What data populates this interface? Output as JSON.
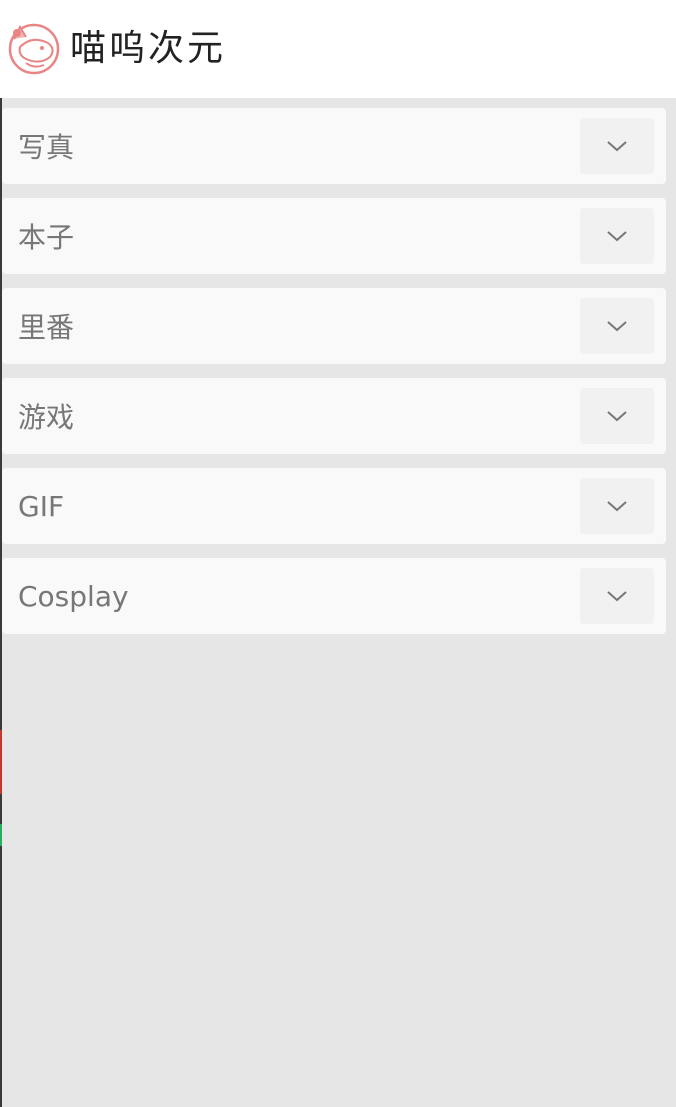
{
  "header": {
    "title": "喵呜次元",
    "logo_icon": "cat-logo-icon",
    "accent_color": "#e98585"
  },
  "menu": {
    "items": [
      {
        "label": "写真",
        "icon": "chevron-down-icon"
      },
      {
        "label": "本子",
        "icon": "chevron-down-icon"
      },
      {
        "label": "里番",
        "icon": "chevron-down-icon"
      },
      {
        "label": "游戏",
        "icon": "chevron-down-icon"
      },
      {
        "label": "GIF",
        "icon": "chevron-down-icon"
      },
      {
        "label": "Cosplay",
        "icon": "chevron-down-icon"
      }
    ]
  }
}
